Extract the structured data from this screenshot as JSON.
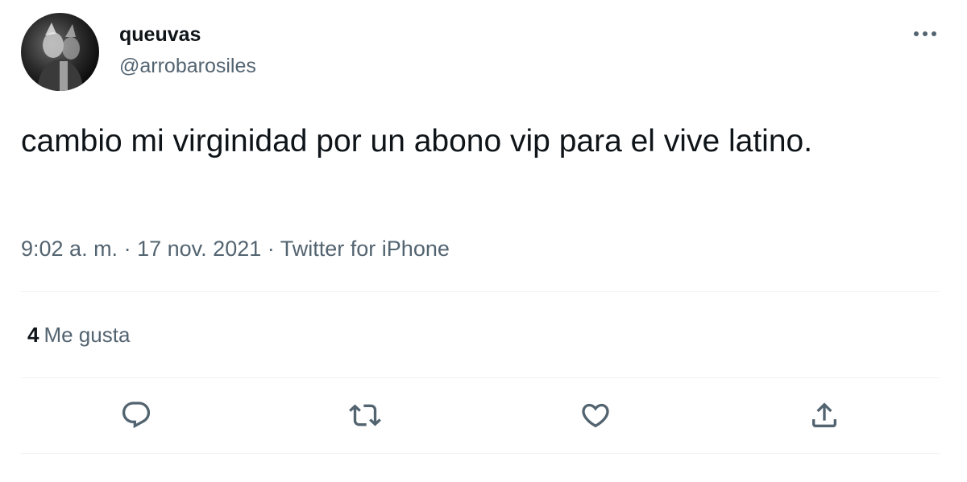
{
  "author": {
    "display_name": "queuvas",
    "handle": "@arrobarosiles",
    "avatar_icon": "profile-photo"
  },
  "tweet": {
    "text": "cambio mi virginidad por un abono vip para el vive latino.",
    "time": "9:02 a. m.",
    "separator": "·",
    "date": "17 nov. 2021",
    "source": "Twitter for iPhone"
  },
  "stats": {
    "likes_count": "4",
    "likes_label": "Me gusta"
  },
  "actions": {
    "reply_icon": "reply-icon",
    "retweet_icon": "retweet-icon",
    "like_icon": "heart-icon",
    "share_icon": "share-icon",
    "more_icon": "more-icon"
  },
  "colors": {
    "text": "#0f1419",
    "secondary": "#536471",
    "divider": "#eff3f4",
    "background": "#ffffff"
  }
}
